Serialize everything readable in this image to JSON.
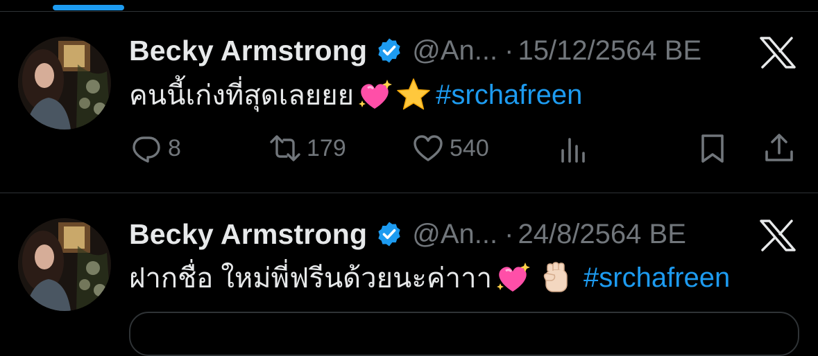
{
  "colors": {
    "background": "#000000",
    "text": "#e7e9ea",
    "muted": "#71767b",
    "accent": "#1d9bf0",
    "divider": "#2f3336"
  },
  "tweets": [
    {
      "name": "Becky Armstrong",
      "handle": "@An...",
      "separator": "·",
      "date": "15/12/2564 BE",
      "text": "คนนี้เก่งที่สุดเลยยย",
      "emojis": [
        "sparkling-heart",
        "star"
      ],
      "hashtag": "#srchafreen",
      "replies": "8",
      "retweets": "179",
      "likes": "540"
    },
    {
      "name": "Becky Armstrong",
      "handle": "@An...",
      "separator": "·",
      "date": "24/8/2564 BE",
      "text": "ฝากชื่อ ใหม่พี่ฟรีนด้วยนะค่าาา",
      "emojis": [
        "sparkling-heart",
        "raised-fist"
      ],
      "hashtag": "#srchafreen"
    }
  ],
  "icons": {
    "verified": "verified-badge-icon",
    "close": "x-icon",
    "reply": "reply-icon",
    "retweet": "retweet-icon",
    "like": "heart-icon",
    "views": "views-icon",
    "bookmark": "bookmark-icon",
    "share": "share-icon"
  }
}
